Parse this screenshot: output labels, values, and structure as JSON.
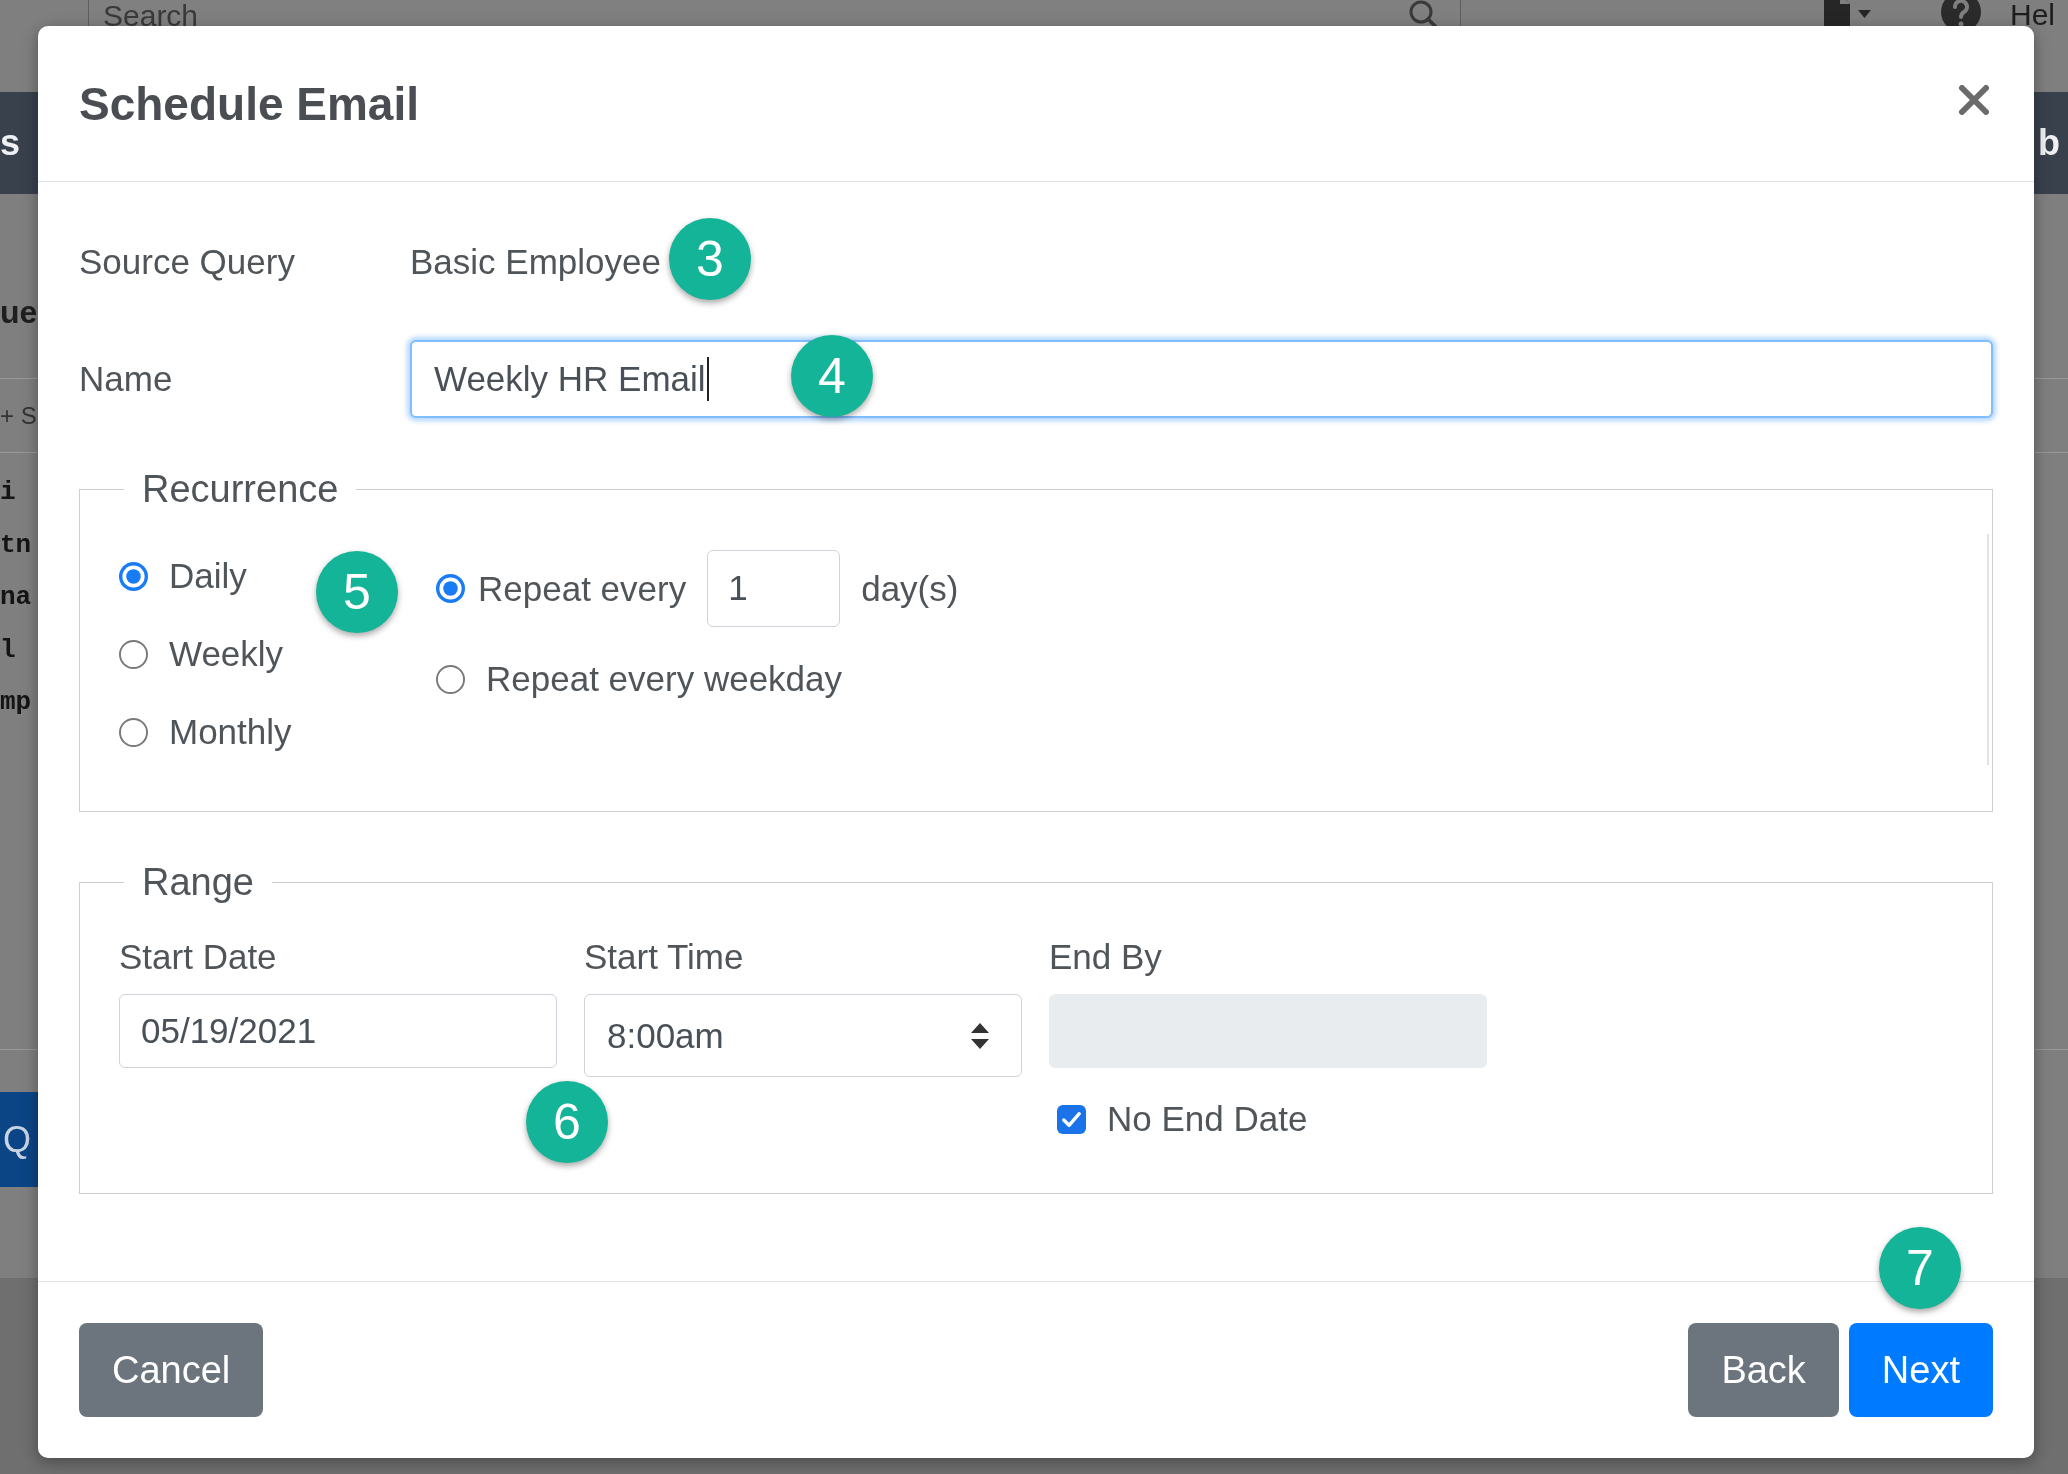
{
  "background_page": {
    "search_field": {
      "placeholder": "Search"
    },
    "help_link": "Hel",
    "navbar_texts": [
      "s",
      "b"
    ],
    "heading": "ue",
    "toolbar_text": "+ S",
    "code_lines": [
      "i",
      "tn",
      "na",
      "l",
      "mp"
    ],
    "button_label": "Q"
  },
  "dialog": {
    "title": "Schedule Email",
    "fields": [
      {
        "label": "Source Query",
        "kind": "text",
        "value": "Basic Employee"
      },
      {
        "label": "Name",
        "kind": "input",
        "value": "Weekly HR Email",
        "focused": true
      }
    ],
    "recurrence": {
      "legend": "Recurrence",
      "patterns": [
        {
          "label": "Daily",
          "selected": true
        },
        {
          "label": "Weekly",
          "selected": false
        },
        {
          "label": "Monthly",
          "selected": false
        }
      ],
      "options": [
        {
          "kind": "interval",
          "label": "Repeat every",
          "selected": true,
          "value": "1",
          "unit": "day(s)"
        },
        {
          "kind": "plain",
          "label": "Repeat every weekday",
          "selected": false
        }
      ]
    },
    "range": {
      "legend": "Range",
      "start_date": {
        "label": "Start Date",
        "value": "05/19/2021"
      },
      "start_time": {
        "label": "Start Time",
        "value": "8:00am"
      },
      "end_by": {
        "label": "End By",
        "disabled": true
      },
      "no_end_date": {
        "label": "No End Date",
        "checked": true
      }
    },
    "buttons": [
      {
        "label": "Cancel",
        "kind": "secondary"
      },
      {
        "label": "Back",
        "kind": "secondary"
      },
      {
        "label": "Next",
        "kind": "primary"
      }
    ]
  },
  "callouts": [
    "3",
    "4",
    "5",
    "6",
    "7"
  ]
}
